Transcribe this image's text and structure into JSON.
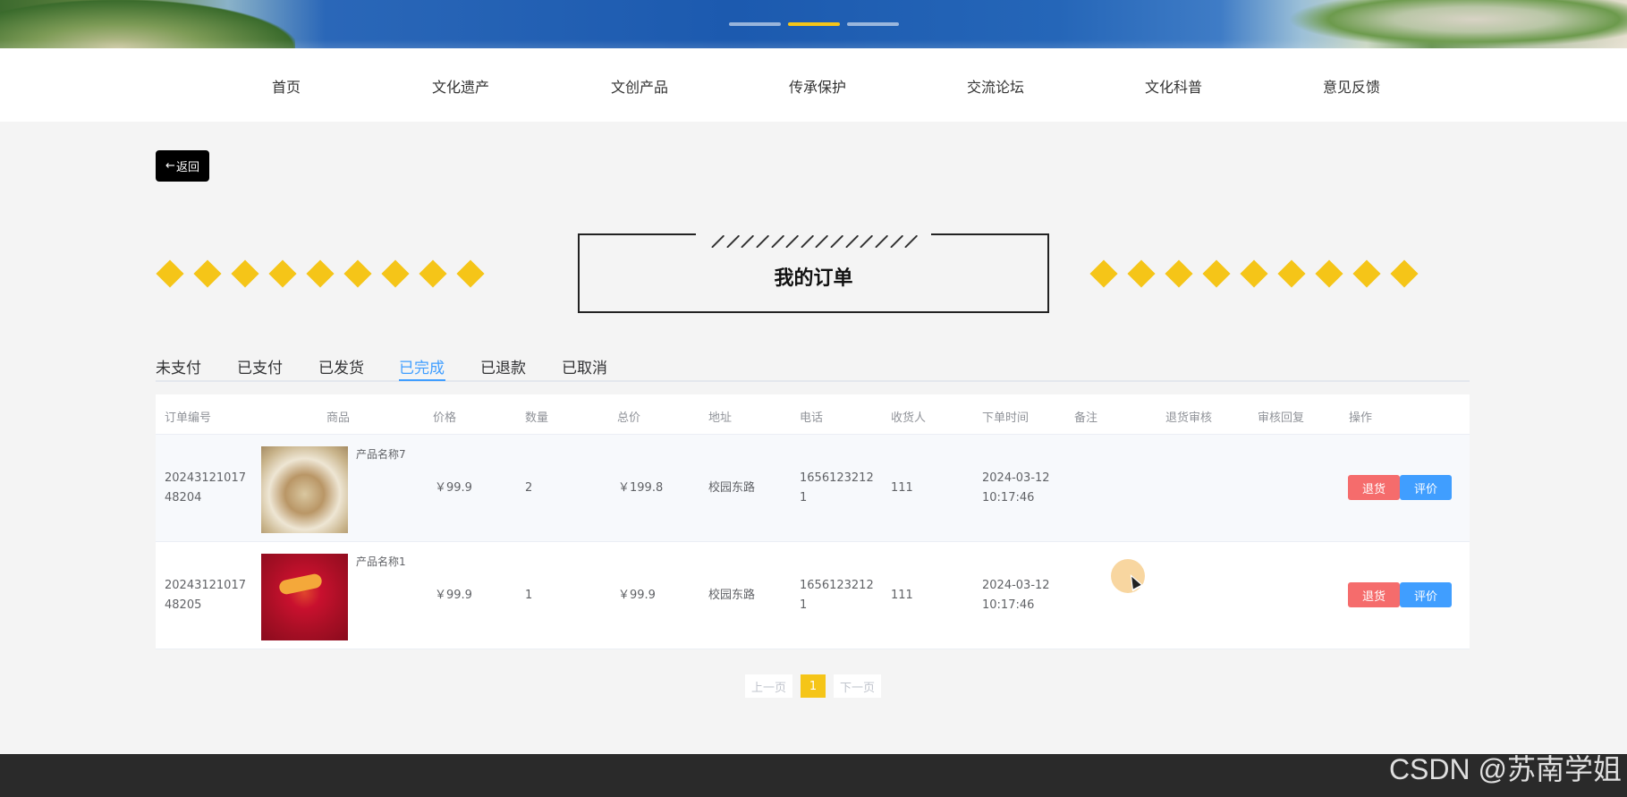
{
  "banner": {
    "dots": 3,
    "active_dot": 2
  },
  "nav": {
    "items": [
      "首页",
      "文化遗产",
      "文创产品",
      "传承保护",
      "交流论坛",
      "文化科普",
      "意见反馈"
    ]
  },
  "back": {
    "arrow": "←",
    "label": "返回"
  },
  "title": "我的订单",
  "tabs": {
    "items": [
      "未支付",
      "已支付",
      "已发货",
      "已完成",
      "已退款",
      "已取消"
    ],
    "active": "已完成"
  },
  "table": {
    "headers": [
      "订单编号",
      "商品",
      "价格",
      "数量",
      "总价",
      "地址",
      "电话",
      "收货人",
      "下单时间",
      "备注",
      "退货审核",
      "审核回复",
      "操作"
    ],
    "rows": [
      {
        "order_no_1": "20243121017",
        "order_no_2": "48204",
        "product_name": "产品名称7",
        "price": "￥99.9",
        "quantity": "2",
        "total": "￥199.8",
        "address": "校园东路",
        "phone_1": "1656123212",
        "phone_2": "1",
        "receiver": "111",
        "date": "2024-03-12",
        "time": "10:17:46",
        "remark": "",
        "return_review": "",
        "review_reply": "",
        "return_label": "退货",
        "review_label": "评价"
      },
      {
        "order_no_1": "20243121017",
        "order_no_2": "48205",
        "product_name": "产品名称1",
        "price": "￥99.9",
        "quantity": "1",
        "total": "￥99.9",
        "address": "校园东路",
        "phone_1": "1656123212",
        "phone_2": "1",
        "receiver": "111",
        "date": "2024-03-12",
        "time": "10:17:46",
        "remark": "",
        "return_review": "",
        "review_reply": "",
        "return_label": "退货",
        "review_label": "评价"
      }
    ]
  },
  "pagination": {
    "prev": "上一页",
    "current": "1",
    "next": "下一页"
  },
  "watermark": "CSDN @苏南学姐",
  "colors": {
    "accent": "#f5c518",
    "tab_active": "#409eff",
    "return_btn": "#f56c6c",
    "review_btn": "#409eff"
  }
}
